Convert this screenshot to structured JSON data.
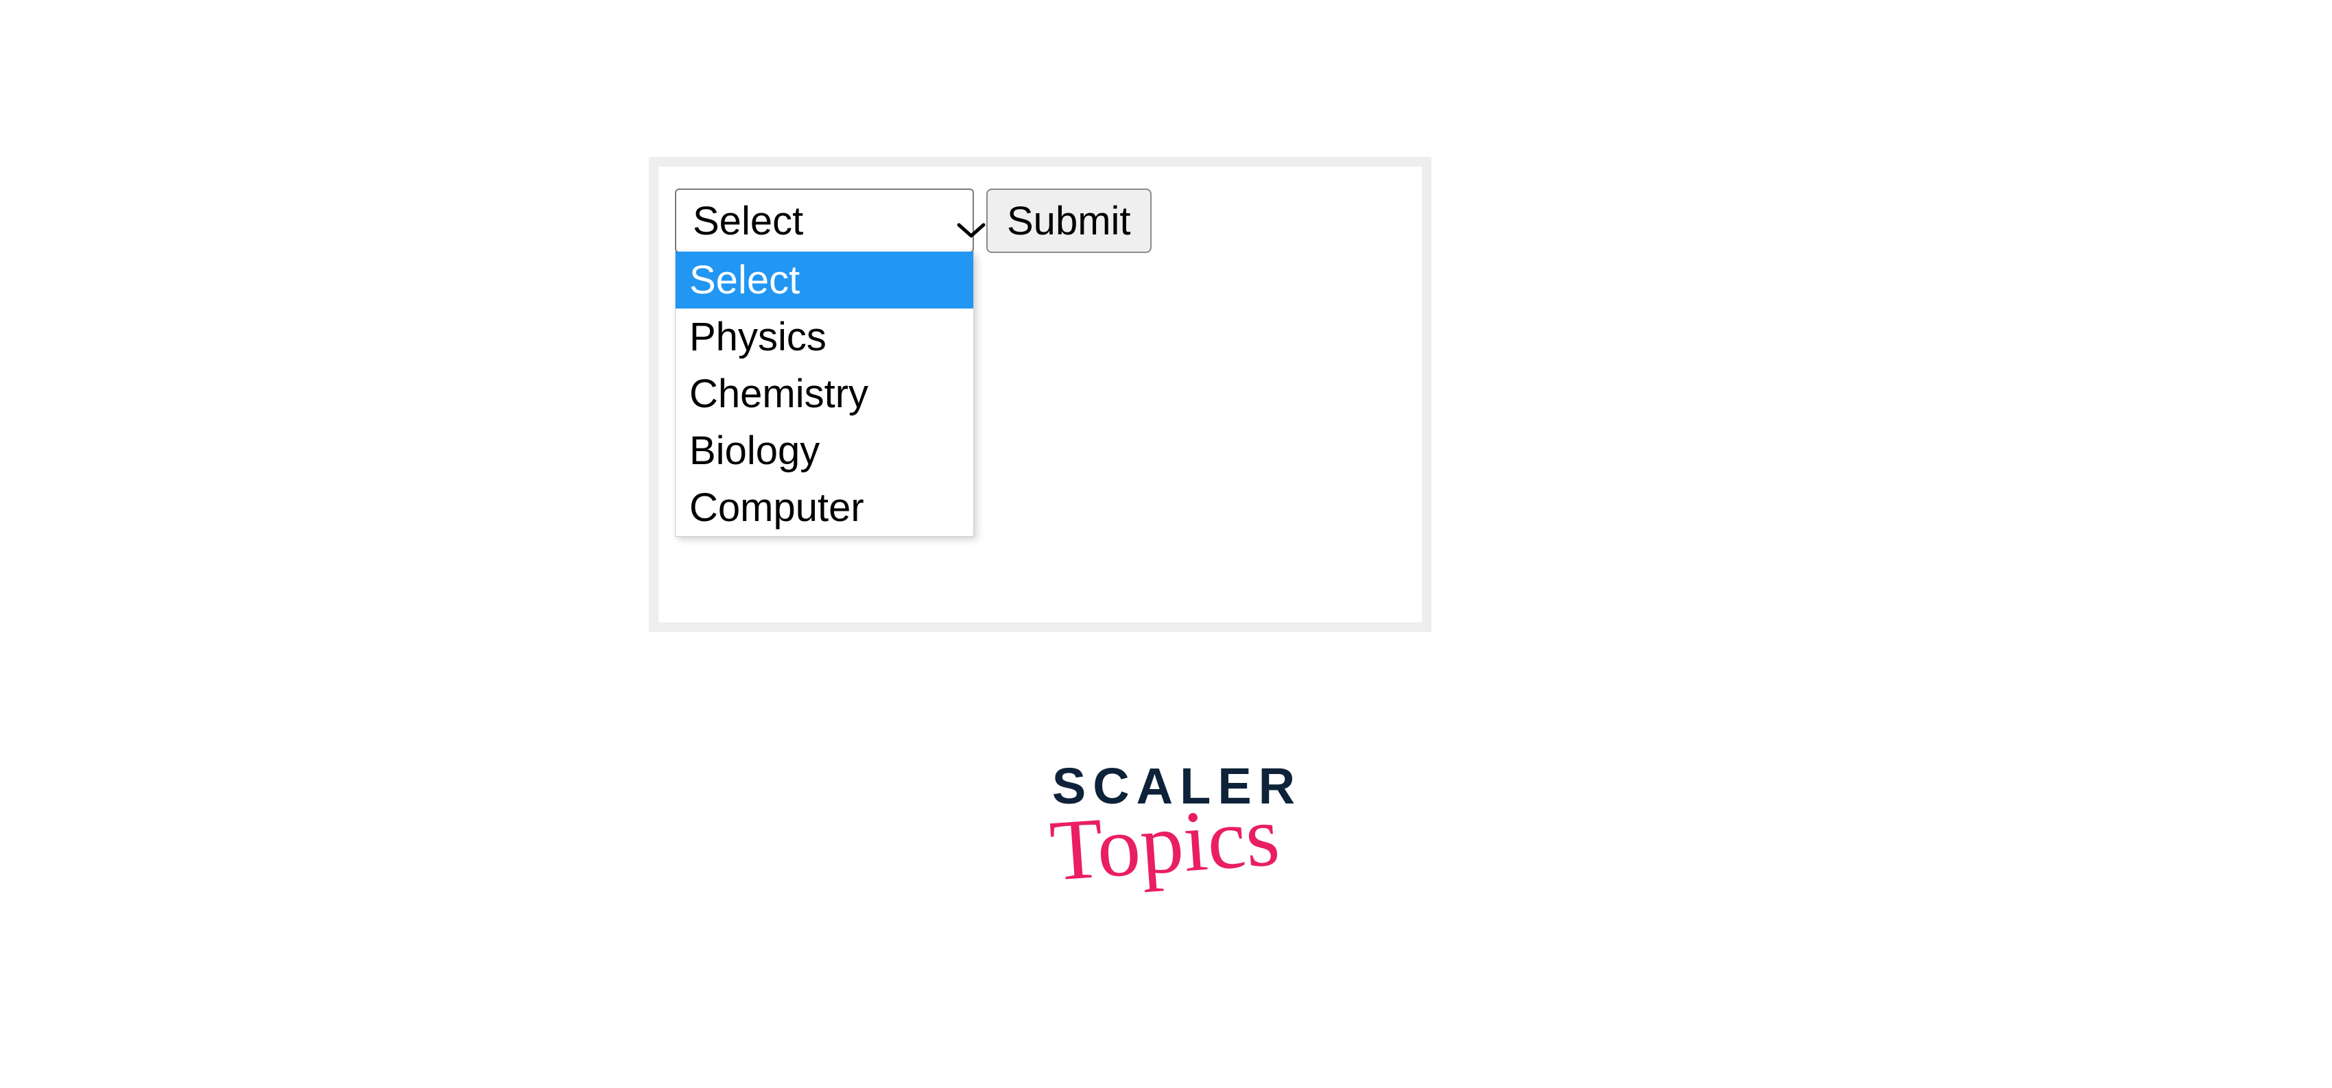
{
  "form": {
    "select": {
      "selected_label": "Select",
      "options": [
        "Select",
        "Physics",
        "Chemistry",
        "Biology",
        "Computer"
      ]
    },
    "submit_label": "Submit"
  },
  "logo": {
    "line1": "SCALER",
    "line2": "Topics"
  },
  "colors": {
    "highlight": "#2196f3",
    "border": "#7a7a7a",
    "panel_border": "#eeeeee",
    "logo_dark": "#0e2239",
    "logo_accent": "#e91e63"
  }
}
